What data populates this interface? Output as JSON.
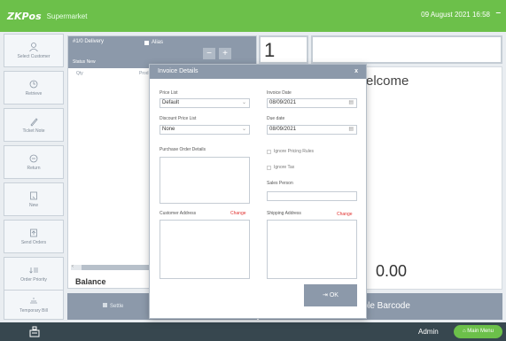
{
  "topbar": {
    "brand": "ZKPos",
    "brand_sub": "Supermarket",
    "datetime": "09 August 2021 16:58",
    "minimize_label": "–",
    "color": "#6cc04a"
  },
  "sidebar": {
    "items": [
      {
        "label": "Select Customer",
        "icon": "user-icon"
      },
      {
        "label": "Retrieve",
        "icon": "retrieve-icon"
      },
      {
        "label": "Ticket Note",
        "icon": "note-icon"
      },
      {
        "label": "Return",
        "icon": "return-icon"
      },
      {
        "label": "New",
        "icon": "new-icon"
      },
      {
        "label": "Send Orders",
        "icon": "send-icon"
      },
      {
        "label": "Order Priority",
        "icon": "priority-icon"
      },
      {
        "label": "Temporary Bill",
        "icon": "bill-icon"
      }
    ]
  },
  "order_panel": {
    "order_label": "#1/0 Delivery",
    "status_label": "Status  New",
    "checkbox_label": "Alias",
    "minus_label": "−",
    "plus_label": "+",
    "col_qty": "Qty",
    "col_product": "Prod",
    "scroll_left": "‹",
    "balance_label": "Balance",
    "settle_label": "Settle"
  },
  "right": {
    "qty_display": "1",
    "welcome": "elcome",
    "total": "0.00",
    "barcode_label": "able Barcode"
  },
  "footer": {
    "admin_label": "Admin",
    "main_menu_label": "Main Menu",
    "icon": "register-icon"
  },
  "modal": {
    "title": "Invoice Details",
    "close_label": "x",
    "price_list_label": "Price List",
    "price_list_value": "Default",
    "invoice_date_label": "Invoice Date",
    "invoice_date_value": "08/09/2021",
    "discount_price_list_label": "Discount Price List",
    "discount_price_list_value": "None",
    "due_date_label": "Due date",
    "due_date_value": "08/09/2021",
    "purchase_order_label": "Purchase Order Details",
    "ignore_pricing_label": "Ignore Pricing Rules",
    "ignore_tax_label": "Ignore Tax",
    "sales_person_label": "Sales Person",
    "sales_person_value": "",
    "customer_address_label": "Customer Address",
    "shipping_address_label": "Shipping Address",
    "change_label": "Change",
    "ok_label": "OK"
  }
}
